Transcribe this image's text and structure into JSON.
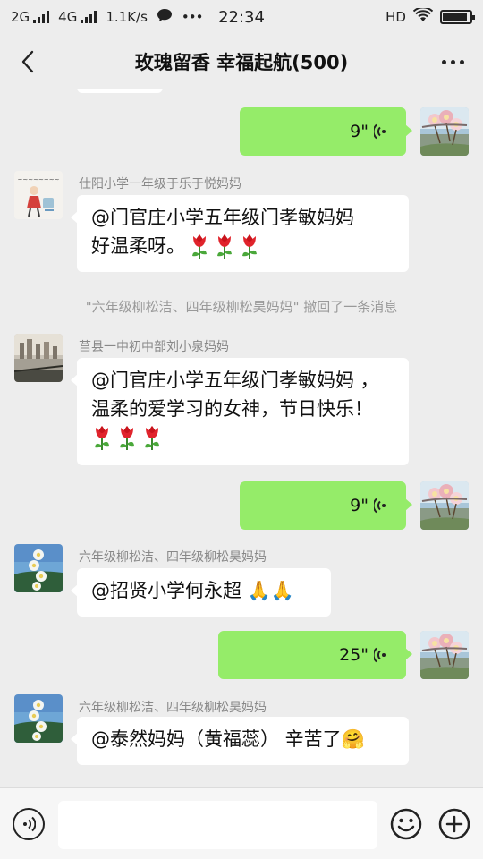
{
  "status_bar": {
    "network_1": "2G",
    "network_2": "4G",
    "speed": "1.1K/s",
    "dots": "•••",
    "time": "22:34",
    "hd": "HD",
    "battery_level": 0.9
  },
  "header": {
    "title": "玫瑰留香  幸福起航(500)"
  },
  "messages": [
    {
      "type": "voice",
      "side": "right",
      "duration": "9\""
    },
    {
      "type": "text",
      "side": "left",
      "sender": "仕阳小学一年级于乐于悦妈妈",
      "lines": [
        "@门官庄小学五年级门孝敏妈妈",
        "好温柔呀。"
      ],
      "emoji_count": 3
    },
    {
      "type": "system",
      "text": "\"六年级柳松洁、四年级柳松昊妈妈\" 撤回了一条消息"
    },
    {
      "type": "text",
      "side": "left",
      "sender": "莒县一中初中部刘小泉妈妈",
      "lines": [
        "@门官庄小学五年级门孝敏妈妈 ，",
        "温柔的爱学习的女神，节日快乐！"
      ],
      "emoji_count": 3
    },
    {
      "type": "voice",
      "side": "right",
      "duration": "9\""
    },
    {
      "type": "text",
      "side": "left",
      "sender": "六年级柳松洁、四年级柳松昊妈妈",
      "lines": [
        "@招贤小学何永超 🙏🙏"
      ]
    },
    {
      "type": "voice",
      "side": "right",
      "duration": "25\""
    },
    {
      "type": "text",
      "side": "left",
      "sender": "六年级柳松洁、四年级柳松昊妈妈",
      "lines": [
        "@泰然妈妈（黄福蕊）  辛苦了🤗"
      ]
    }
  ],
  "input_bar": {
    "placeholder": ""
  },
  "colors": {
    "background": "#ededed",
    "voice_bubble": "#95ec69",
    "text_bubble": "#ffffff"
  },
  "icons": [
    "back-arrow-icon",
    "more-dots-icon",
    "voice-wave-icon",
    "tulip-emoji-icon",
    "voice-input-icon",
    "emoji-icon",
    "plus-icon"
  ]
}
